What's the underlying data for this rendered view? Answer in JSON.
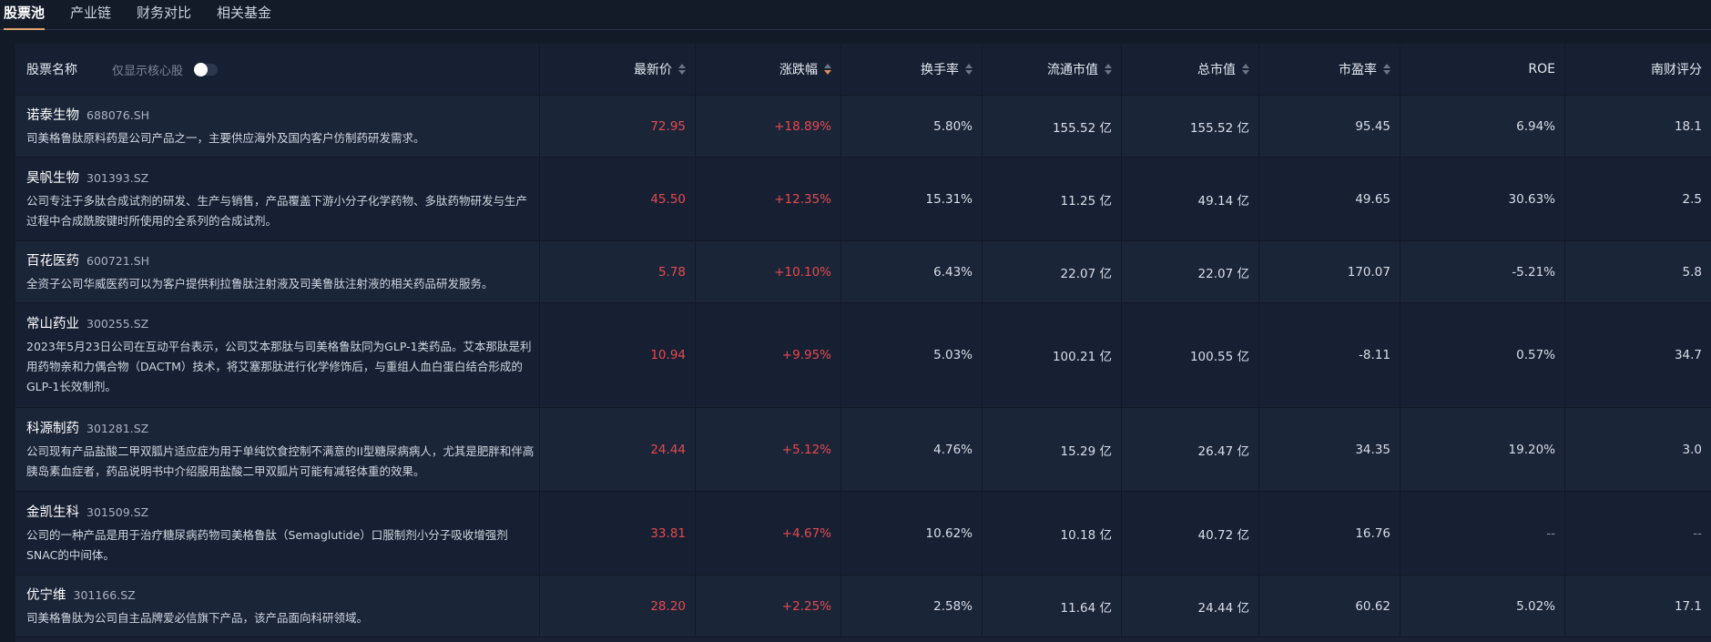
{
  "tabs": [
    "股票池",
    "产业链",
    "财务对比",
    "相关基金"
  ],
  "header": {
    "name": "股票名称",
    "core_only": "仅显示核心股",
    "price": "最新价",
    "change": "涨跌幅",
    "turnover": "换手率",
    "float_cap": "流通市值",
    "total_cap": "总市值",
    "pe": "市盈率",
    "roe": "ROE",
    "score": "南财评分"
  },
  "colors": {
    "up": "#e8484d",
    "sort_active": "#e08a55",
    "tab_underline": "#e0a36a"
  },
  "stocks": [
    {
      "name": "诺泰生物",
      "code": "688076.SH",
      "desc": "司美格鲁肽原料药是公司产品之一，主要供应海外及国内客户仿制药研发需求。",
      "price": "72.95",
      "change": "+18.89%",
      "turnover": "5.80%",
      "float_cap": "155.52 亿",
      "total_cap": "155.52 亿",
      "pe": "95.45",
      "roe": "6.94%",
      "score": "18.1"
    },
    {
      "name": "昊帆生物",
      "code": "301393.SZ",
      "desc": "公司专注于多肽合成试剂的研发、生产与销售，产品覆盖下游小分子化学药物、多肽药物研发与生产过程中合成酰胺键时所使用的全系列的合成试剂。",
      "price": "45.50",
      "change": "+12.35%",
      "turnover": "15.31%",
      "float_cap": "11.25 亿",
      "total_cap": "49.14 亿",
      "pe": "49.65",
      "roe": "30.63%",
      "score": "2.5"
    },
    {
      "name": "百花医药",
      "code": "600721.SH",
      "desc": "全资子公司华威医药可以为客户提供利拉鲁肽注射液及司美鲁肽注射液的相关药品研发服务。",
      "price": "5.78",
      "change": "+10.10%",
      "turnover": "6.43%",
      "float_cap": "22.07 亿",
      "total_cap": "22.07 亿",
      "pe": "170.07",
      "roe": "-5.21%",
      "score": "5.8"
    },
    {
      "name": "常山药业",
      "code": "300255.SZ",
      "desc": "2023年5月23日公司在互动平台表示，公司艾本那肽与司美格鲁肽同为GLP-1类药品。艾本那肽是利用药物亲和力偶合物（DACTM）技术，将艾塞那肽进行化学修饰后，与重组人血白蛋白结合形成的GLP-1长效制剂。",
      "price": "10.94",
      "change": "+9.95%",
      "turnover": "5.03%",
      "float_cap": "100.21 亿",
      "total_cap": "100.55 亿",
      "pe": "-8.11",
      "roe": "0.57%",
      "score": "34.7"
    },
    {
      "name": "科源制药",
      "code": "301281.SZ",
      "desc": "公司现有产品盐酸二甲双胍片适应症为用于单纯饮食控制不满意的II型糖尿病病人，尤其是肥胖和伴高胰岛素血症者，药品说明书中介绍服用盐酸二甲双胍片可能有减轻体重的效果。",
      "price": "24.44",
      "change": "+5.12%",
      "turnover": "4.76%",
      "float_cap": "15.29 亿",
      "total_cap": "26.47 亿",
      "pe": "34.35",
      "roe": "19.20%",
      "score": "3.0"
    },
    {
      "name": "金凯生科",
      "code": "301509.SZ",
      "desc": "公司的一种产品是用于治疗糖尿病药物司美格鲁肽（Semaglutide）口服制剂小分子吸收增强剂SNAC的中间体。",
      "price": "33.81",
      "change": "+4.67%",
      "turnover": "10.62%",
      "float_cap": "10.18 亿",
      "total_cap": "40.72 亿",
      "pe": "16.76",
      "roe": "--",
      "score": "--"
    },
    {
      "name": "优宁维",
      "code": "301166.SZ",
      "desc": "司美格鲁肽为公司自主品牌爱必信旗下产品，该产品面向科研领域。",
      "price": "28.20",
      "change": "+2.25%",
      "turnover": "2.58%",
      "float_cap": "11.64 亿",
      "total_cap": "24.44 亿",
      "pe": "60.62",
      "roe": "5.02%",
      "score": "17.1"
    }
  ]
}
